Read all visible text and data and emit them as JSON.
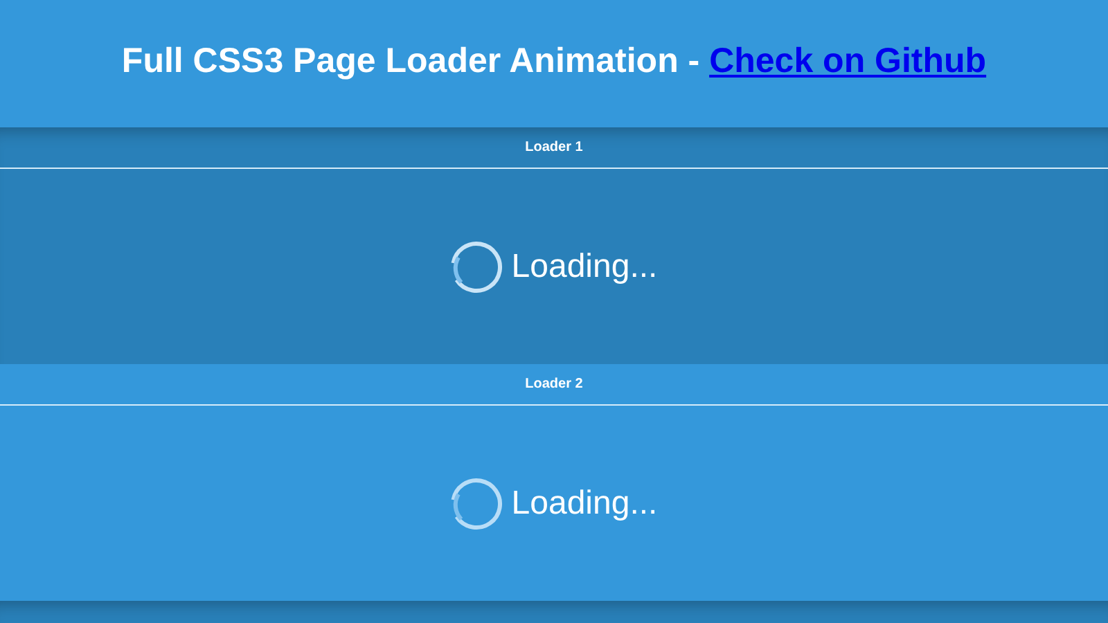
{
  "heading": {
    "text": "Full CSS3 Page Loader Animation - ",
    "link": "Check on Github"
  },
  "loaders": [
    {
      "label": "Loader 1",
      "text": "Loading..."
    },
    {
      "label": "Loader 2",
      "text": "Loading..."
    }
  ],
  "more_sections": true
}
